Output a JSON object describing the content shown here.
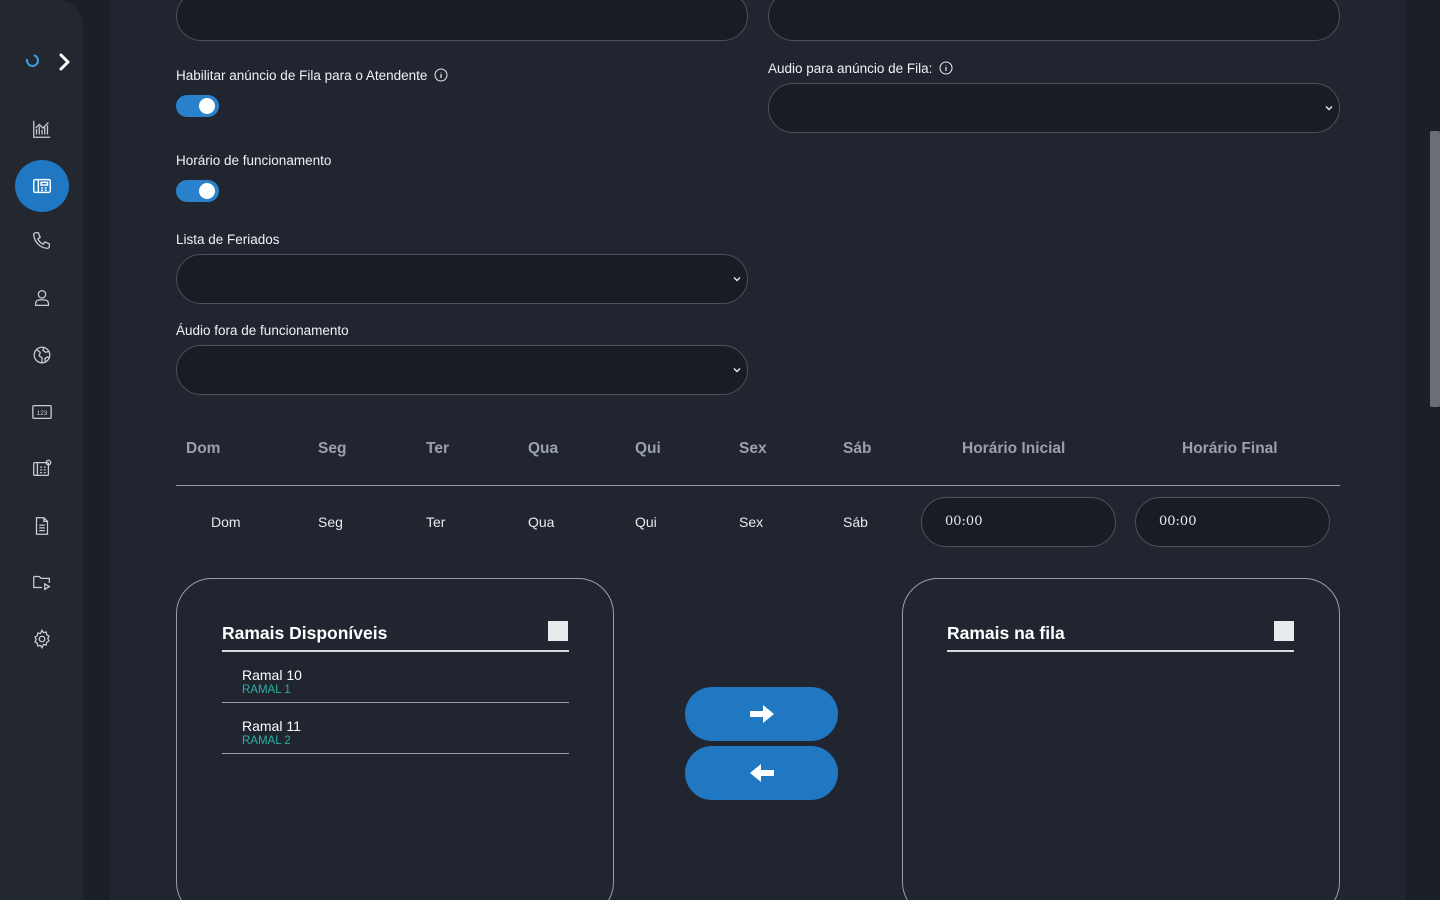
{
  "form": {
    "announce_label": "Habilitar anúncio de Fila para o Atendente",
    "announce_audio_label": "Audio para anúncio de Fila:",
    "business_hours_label": "Horário de funcionamento",
    "holidays_label": "Lista de Feriados",
    "offhours_audio_label": "Áudio fora de funcionamento",
    "announce_enabled": true,
    "business_hours_enabled": true
  },
  "schedule": {
    "headers": [
      "Dom",
      "Seg",
      "Ter",
      "Qua",
      "Qui",
      "Sex",
      "Sáb",
      "Horário Inicial",
      "Horário Final"
    ],
    "days": [
      "Dom",
      "Seg",
      "Ter",
      "Qua",
      "Qui",
      "Sex",
      "Sáb"
    ],
    "start_time": "00:00",
    "end_time": "00:00"
  },
  "available": {
    "title": "Ramais Disponíveis",
    "items": [
      {
        "name": "Ramal 10",
        "sub": "RAMAL 1"
      },
      {
        "name": "Ramal 11",
        "sub": "RAMAL 2"
      }
    ]
  },
  "in_queue": {
    "title": "Ramais na fila",
    "items": []
  },
  "colors": {
    "accent": "#1f78c1",
    "extension_sub": "#2bb0a4",
    "panel": "#202530",
    "sidebar": "#23272f"
  },
  "sidebar": {
    "icons": [
      "chart-icon",
      "queue-icon",
      "phone-icon",
      "user-icon",
      "globe-icon",
      "numeric-icon",
      "ivr-icon",
      "document-icon",
      "media-folder-icon",
      "settings-icon"
    ]
  }
}
